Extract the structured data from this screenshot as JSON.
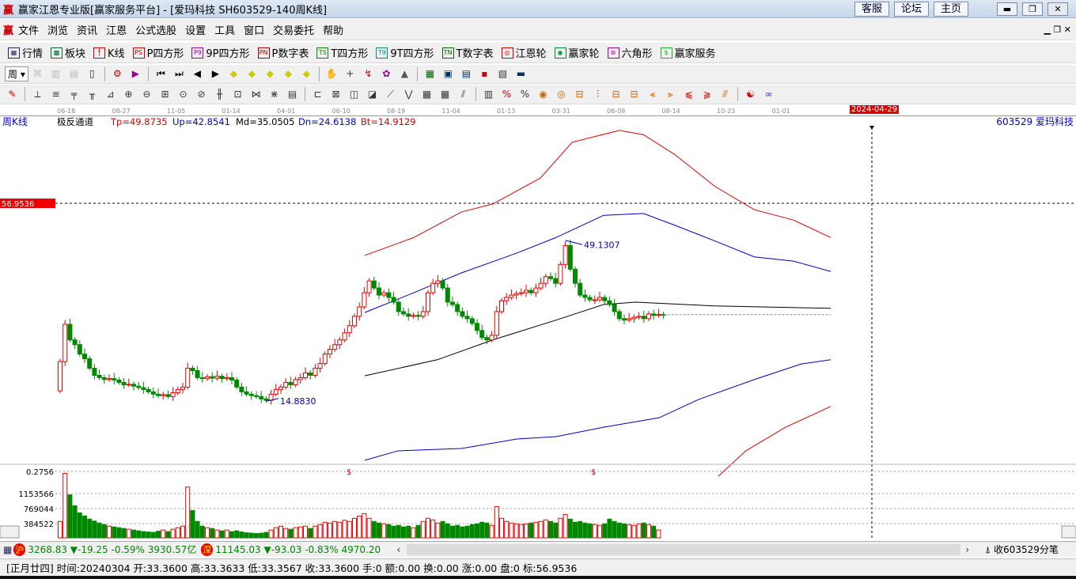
{
  "title": {
    "logo": "赢",
    "text": "赢家江恩专业版[赢家服务平台] - [爱玛科技  SH603529-140周K线]",
    "links": [
      "客服",
      "论坛",
      "主页"
    ]
  },
  "menu": {
    "logo": "赢",
    "items": [
      "文件",
      "浏览",
      "资讯",
      "江恩",
      "公式选股",
      "设置",
      "工具",
      "窗口",
      "交易委托",
      "帮助"
    ]
  },
  "toolbar1": [
    {
      "icon": "table-icon",
      "tag": "▦",
      "label": "行情"
    },
    {
      "icon": "blocks-icon",
      "tag": "▩",
      "label": "板块"
    },
    {
      "icon": "kline-icon",
      "tag": "╿",
      "label": "K线"
    },
    {
      "icon": "ps-icon",
      "tag": "PS",
      "label": "P四方形"
    },
    {
      "icon": "p9-icon",
      "tag": "P9",
      "label": "9P四方形"
    },
    {
      "icon": "pn-icon",
      "tag": "PN",
      "label": "P数字表"
    },
    {
      "icon": "ts-icon",
      "tag": "TS",
      "label": "T四方形"
    },
    {
      "icon": "t9-icon",
      "tag": "T9",
      "label": "9T四方形"
    },
    {
      "icon": "tn-icon",
      "tag": "TN",
      "label": "T数字表"
    },
    {
      "icon": "gann-wheel-icon",
      "tag": "◎",
      "label": "江恩轮"
    },
    {
      "icon": "winner-wheel-icon",
      "tag": "◉",
      "label": "赢家轮"
    },
    {
      "icon": "hexagon-icon",
      "tag": "⊛",
      "label": "六角形"
    },
    {
      "icon": "dollar-icon",
      "tag": "$",
      "label": "赢家服务"
    }
  ],
  "toolbar2": {
    "period": "周"
  },
  "dateaxis": {
    "ticks": [
      "06-18",
      "08-27",
      "11-05",
      "01-14",
      "04-01",
      "06-10",
      "08-19",
      "11-04",
      "01-13",
      "03-31",
      "06-09",
      "08-14",
      "10-23",
      "01-01"
    ],
    "cursor_date": "2024-04-29"
  },
  "chart_header": {
    "period": "周K线",
    "indicator": "极反通道",
    "tp": "Tp=49.8735",
    "up": "Up=42.8541",
    "md": "Md=35.0505",
    "dn": "Dn=24.6138",
    "bt": "Bt=14.9129",
    "stock": "603529  爱玛科技"
  },
  "price_marker": "56.9536",
  "annotations": {
    "high": "49.1307",
    "low": "14.8830",
    "signal": "$"
  },
  "volume_axis": [
    "0.2756",
    "1153566",
    "769044",
    "384522"
  ],
  "chart_data": {
    "type": "candlestick",
    "price_ref": {
      "top": 56.9536,
      "low": 14.883
    },
    "closes": [
      23.4,
      31.3,
      28,
      27,
      25,
      24,
      22,
      20.5,
      20,
      19.6,
      19.8,
      19.5,
      19,
      18.5,
      18.6,
      18.2,
      17.9,
      17.5,
      17,
      16.5,
      16.2,
      16.4,
      16,
      16.8,
      17.5,
      18,
      22,
      21.5,
      20,
      19.8,
      20.2,
      19.9,
      20.3,
      19.8,
      20,
      19.5,
      18,
      17,
      16.5,
      16.2,
      16,
      15.5,
      15.2,
      16.5,
      17.5,
      18,
      19,
      18.5,
      19.6,
      20,
      21,
      20.5,
      22,
      23,
      25,
      26,
      27,
      28,
      29.5,
      31,
      33,
      35,
      38,
      40.5,
      39,
      37.5,
      38,
      37,
      36,
      34,
      33.5,
      33,
      33.2,
      33,
      34,
      38,
      40,
      40.5,
      39,
      36,
      35.5,
      34,
      33,
      32.5,
      31.5,
      30,
      28.5,
      28,
      29,
      34,
      36.3,
      37,
      37.5,
      37.8,
      38,
      38.5,
      38,
      39,
      40,
      41.4,
      41,
      40,
      44,
      48,
      43,
      40,
      37.5,
      37,
      36.5,
      36.5,
      37,
      36.3,
      35.5,
      34,
      32.5,
      32.2,
      32.5,
      32.8,
      33,
      32.5,
      33.5,
      33.2,
      33.4,
      33.36
    ],
    "first_open": 17.2,
    "volumes": [
      420000,
      1650000,
      1100000,
      820000,
      640000,
      560000,
      480000,
      430000,
      380000,
      340000,
      300000,
      280000,
      260000,
      240000,
      220000,
      200000,
      180000,
      160000,
      150000,
      140000,
      170000,
      200000,
      160000,
      220000,
      260000,
      300000,
      1300000,
      700000,
      420000,
      300000,
      260000,
      240000,
      200000,
      180000,
      200000,
      160000,
      180000,
      150000,
      130000,
      120000,
      110000,
      120000,
      140000,
      200000,
      260000,
      300000,
      240000,
      220000,
      260000,
      280000,
      300000,
      240000,
      300000,
      340000,
      400000,
      380000,
      420000,
      400000,
      450000,
      420000,
      500000,
      560000,
      620000,
      500000,
      420000,
      380000,
      360000,
      340000,
      300000,
      320000,
      280000,
      300000,
      260000,
      320000,
      420000,
      500000,
      460000,
      380000,
      420000,
      360000,
      300000,
      320000,
      280000,
      300000,
      340000,
      360000,
      400000,
      380000,
      320000,
      800000,
      500000,
      420000,
      380000,
      360000,
      340000,
      360000,
      380000,
      400000,
      420000,
      460000,
      420000,
      380000,
      500000,
      600000,
      480000,
      400000,
      420000,
      380000,
      360000,
      340000,
      320000,
      360000,
      480000,
      420000,
      380000,
      360000,
      340000,
      320000,
      360000,
      380000,
      340000,
      300000,
      200000
    ],
    "bands": [
      {
        "name": "Tp",
        "color": "#e00000",
        "points": [
          [
            62.1,
            45.9
          ],
          [
            72.1,
            49.7
          ],
          [
            81.8,
            55.1
          ],
          [
            88.2,
            56.8
          ],
          [
            97.9,
            62.3
          ],
          [
            104.4,
            69.9
          ],
          [
            114,
            72.4
          ],
          [
            118.9,
            71.5
          ],
          [
            125.3,
            67.3
          ],
          [
            133.4,
            60.6
          ],
          [
            141.5,
            55.6
          ],
          [
            149.5,
            53.4
          ],
          [
            157.1,
            49.7
          ]
        ]
      },
      {
        "name": "Up",
        "color": "#0000c8",
        "points": [
          [
            62.1,
            33.8
          ],
          [
            72.1,
            38
          ],
          [
            81.8,
            42.2
          ],
          [
            93.1,
            46.4
          ],
          [
            101.1,
            49.7
          ],
          [
            110.8,
            54.4
          ],
          [
            118.9,
            54.8
          ],
          [
            125.3,
            52.3
          ],
          [
            133.4,
            49
          ],
          [
            141.5,
            45.6
          ],
          [
            149.5,
            44.7
          ],
          [
            157.1,
            42.5
          ]
        ]
      },
      {
        "name": "Md",
        "color": "#000000",
        "points": [
          [
            62.1,
            20.4
          ],
          [
            76.9,
            23.8
          ],
          [
            88.2,
            28
          ],
          [
            101.1,
            32.2
          ],
          [
            110.8,
            35.5
          ],
          [
            117.3,
            36
          ],
          [
            133.4,
            35.2
          ],
          [
            157.1,
            34.7
          ]
        ]
      },
      {
        "name": "Dn",
        "color": "#0000c8",
        "points": [
          [
            62.1,
            2.5
          ],
          [
            68.9,
            4.5
          ],
          [
            81.8,
            5
          ],
          [
            93.1,
            7
          ],
          [
            101.1,
            7.5
          ],
          [
            110.8,
            9.5
          ],
          [
            122.1,
            11.5
          ],
          [
            130.2,
            15.4
          ],
          [
            141.5,
            19.6
          ],
          [
            151.1,
            22.9
          ],
          [
            157.1,
            23.8
          ]
        ]
      },
      {
        "name": "Bt",
        "color": "#e00000",
        "points": [
          [
            134.2,
            -0.9
          ],
          [
            139.8,
            4.5
          ],
          [
            147.9,
            9.5
          ],
          [
            157.1,
            13.9
          ]
        ]
      }
    ]
  },
  "index_bar": {
    "sh_badge": "沪",
    "sh": "3268.83 ▼-19.25 -0.59% 3930.57亿",
    "sz_badge": "深",
    "sz": "11145.03 ▼-93.03 -0.83% 4970.20",
    "right": "收603529分笔"
  },
  "status": "[正月廿四] 时间:20240304 开:33.3600 高:33.3633 低:33.3567 收:33.3600 手:0 额:0.00 换:0.00 涨:0.00 盘:0 标:56.9536"
}
